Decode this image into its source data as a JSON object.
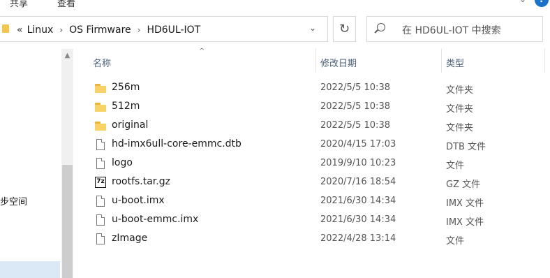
{
  "ribbon": {
    "tab_share": "共享",
    "tab_view": "查看"
  },
  "address": {
    "overflow": "«",
    "crumbs": [
      "Linux",
      "OS Firmware",
      "HD6UL-IOT"
    ]
  },
  "search": {
    "placeholder": "在 HD6UL-IOT 中搜索"
  },
  "nav": {
    "partial_label": "步空间"
  },
  "columns": {
    "name": "名称",
    "date": "修改日期",
    "type": "类型"
  },
  "files": [
    {
      "name": "256m",
      "date": "2022/5/5 10:38",
      "type": "文件夹",
      "icon": "folder-icon"
    },
    {
      "name": "512m",
      "date": "2022/5/5 10:38",
      "type": "文件夹",
      "icon": "folder-icon"
    },
    {
      "name": "original",
      "date": "2022/5/5 10:38",
      "type": "文件夹",
      "icon": "folder-icon"
    },
    {
      "name": "hd-imx6ull-core-emmc.dtb",
      "date": "2020/4/15 17:03",
      "type": "DTB 文件",
      "icon": "file-icon"
    },
    {
      "name": "logo",
      "date": "2019/9/10 10:23",
      "type": "文件",
      "icon": "file-icon"
    },
    {
      "name": "rootfs.tar.gz",
      "date": "2020/7/16 18:54",
      "type": "GZ 文件",
      "icon": "7z-archive-icon"
    },
    {
      "name": "u-boot.imx",
      "date": "2021/6/30 14:34",
      "type": "IMX 文件",
      "icon": "file-icon"
    },
    {
      "name": "u-boot-emmc.imx",
      "date": "2021/6/30 14:34",
      "type": "IMX 文件",
      "icon": "file-icon"
    },
    {
      "name": "zImage",
      "date": "2022/4/28 13:14",
      "type": "文件",
      "icon": "file-icon"
    }
  ]
}
